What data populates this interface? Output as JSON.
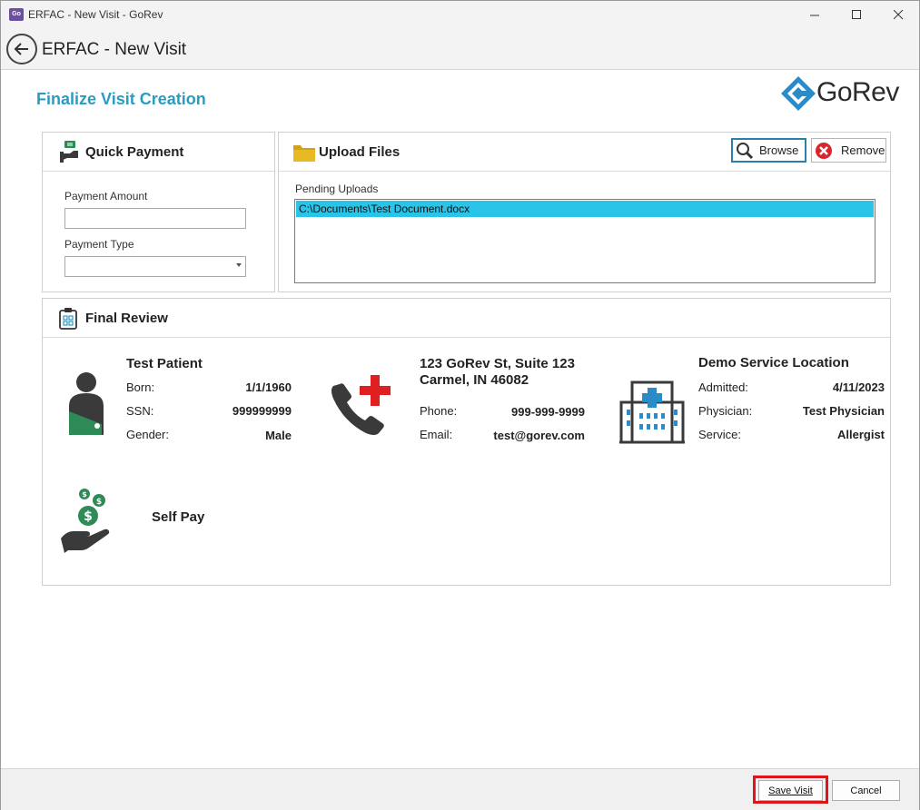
{
  "window": {
    "title": "ERFAC - New Visit - GoRev",
    "app_icon_text": "GoRev",
    "minimize_glyph": "—",
    "maximize_glyph": "☐",
    "close_glyph": "✕"
  },
  "header": {
    "title": "ERFAC - New Visit"
  },
  "page": {
    "title": "Finalize Visit Creation",
    "logo_text": "GoRev",
    "accent_color": "#2a9cc2"
  },
  "quick_payment": {
    "title": "Quick Payment",
    "amount_label": "Payment Amount",
    "amount_value": "",
    "type_label": "Payment Type",
    "type_value": ""
  },
  "upload_files": {
    "title": "Upload Files",
    "browse_label": "Browse",
    "remove_label": "Remove",
    "pending_label": "Pending Uploads",
    "pending_items": [
      "C:\\Documents\\Test Document.docx"
    ]
  },
  "final_review": {
    "title": "Final Review",
    "patient": {
      "name": "Test Patient",
      "born_label": "Born:",
      "born_value": "1/1/1960",
      "ssn_label": "SSN:",
      "ssn_value": "999999999",
      "gender_label": "Gender:",
      "gender_value": "Male"
    },
    "contact": {
      "address_line1": "123 GoRev St, Suite 123",
      "address_line2": "Carmel, IN 46082",
      "phone_label": "Phone:",
      "phone_value": "999-999-9999",
      "email_label": "Email:",
      "email_value": "test@gorev.com"
    },
    "location": {
      "name": "Demo Service Location",
      "admitted_label": "Admitted:",
      "admitted_value": "4/11/2023",
      "physician_label": "Physician:",
      "physician_value": "Test Physician",
      "service_label": "Service:",
      "service_value": "Allergist"
    },
    "payer": {
      "name": "Self Pay"
    }
  },
  "footer": {
    "save_label": "Save Visit",
    "cancel_label": "Cancel",
    "highlight_color": "#e0151b"
  }
}
